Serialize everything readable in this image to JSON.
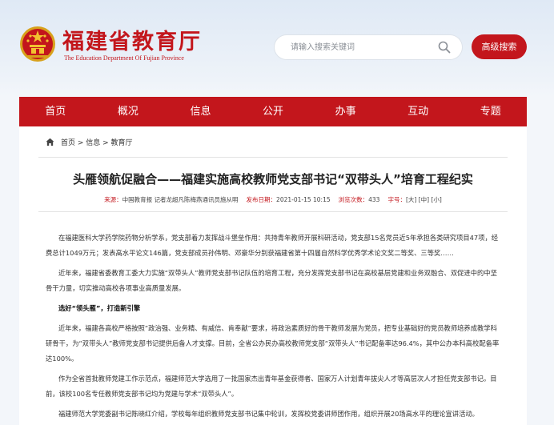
{
  "header": {
    "title": "福建省教育厅",
    "subtitle": "The Education Department Of Fujian Province",
    "search_placeholder": "请输入搜索关键词",
    "advanced_search_label": "高级搜索",
    "brand_color": "#c3161c"
  },
  "nav": {
    "items": [
      {
        "label": "首页"
      },
      {
        "label": "概况"
      },
      {
        "label": "信息"
      },
      {
        "label": "公开"
      },
      {
        "label": "办事"
      },
      {
        "label": "互动"
      },
      {
        "label": "专题"
      }
    ]
  },
  "breadcrumb": {
    "text": "首页 > 信息 > 教育厅"
  },
  "article": {
    "title": "头雁领航促融合——福建实施高校教师党支部书记“双带头人”培育工程纪实",
    "meta": {
      "source_label": "来源：",
      "source": "中国教育报 记者龙超凡陈梅燕通讯员施从明",
      "date_label": "发布日期：",
      "date": "2021-01-15 10:15",
      "views_label": "浏览次数：",
      "views": "433",
      "font_label": "字号：",
      "font_large": "[大]",
      "font_medium": "[中]",
      "font_small": "[小]"
    },
    "paragraphs": [
      "在福建医科大学药学院药物分析学系，党支部着力发挥战斗堡垒作用：共持青年教师开展科研活动，党支部15名党员近5年承担各类研究项目47项，经费总计1049万元；发表高水平论文146篇，党支部成员孙伟明、邓豪华分别获福建省第十四届自然科学优秀学术论文奖二等奖、三等奖……",
      "近年来，福建省委教育工委大力实施“双带头人”教师党支部书记队伍的培育工程，充分发挥党支部书记在高校基层党建和业务双融合、双促进中的中坚骨干力量，切实推动高校各项事业高质量发展。",
      "选好“领头雁”，打造新引擎",
      "近年来，福建各高校严格按照“政治强、业务精、有威信、肯奉献”要求，将政治素质好的骨干教师发展为党员，把专业基础好的党员教师培养成教学科研骨干，为“双带头人”教师党支部书记提供后备人才支撑。目前，全省公办民办高校教师党支部“双带头人”书记配备率达96.4%，其中公办本科高校配备率达100%。",
      "作为全省首批教师党建工作示范点，福建师范大学选用了一批国家杰出青年基金获得者、国家万人计划青年拔尖人才等高层次人才担任党支部书记。目前，该校100名专任教师党支部书记均为党建与学术“双带头人”。",
      "福建师范大学党委副书记陈晓红介绍，学校每年组织教师党支部书记集中轮训，发挥校党委讲师团作用，组织开展20场高水平的理论宣讲活动。"
    ]
  }
}
